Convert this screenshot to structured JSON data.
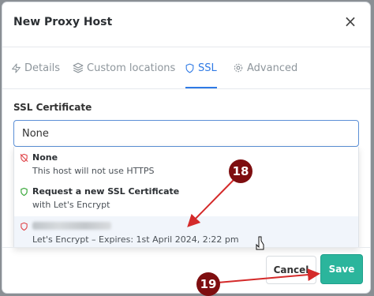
{
  "modal": {
    "title": "New Proxy Host",
    "close_symbol": "×"
  },
  "tabs": [
    {
      "label": "Details",
      "icon": "zap-icon"
    },
    {
      "label": "Custom locations",
      "icon": "layers-icon"
    },
    {
      "label": "SSL",
      "icon": "shield-icon",
      "active": true
    },
    {
      "label": "Advanced",
      "icon": "gear-icon"
    }
  ],
  "ssl": {
    "label": "SSL Certificate",
    "selected_value": "None",
    "options": [
      {
        "title": "None",
        "subtitle": "This host will not use HTTPS",
        "icon": "shield-off-icon",
        "icon_color": "#e0464b"
      },
      {
        "title": "Request a new SSL Certificate",
        "subtitle": "with Let's Encrypt",
        "icon": "shield-icon",
        "icon_color": "#3da93e"
      },
      {
        "title": "",
        "subtitle": "Let's Encrypt – Expires: 1st April 2024, 2:22 pm",
        "icon": "shield-icon",
        "icon_color": "#e0464b",
        "title_redacted": true
      }
    ]
  },
  "footer": {
    "cancel_label": "Cancel",
    "save_label": "Save"
  },
  "annotations": [
    {
      "number": "18"
    },
    {
      "number": "19"
    }
  ],
  "colors": {
    "accent": "#2f7ae5",
    "save": "#2bb59c",
    "badge": "#7e0e10",
    "arrow": "#d42a2a"
  }
}
